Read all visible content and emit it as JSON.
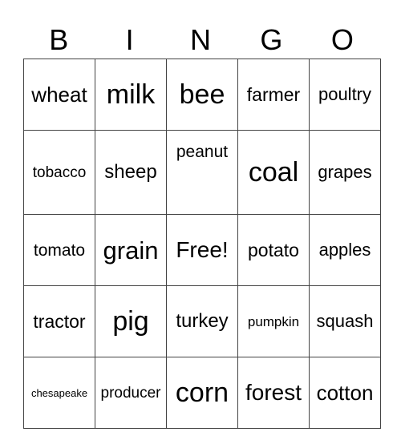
{
  "header": [
    "B",
    "I",
    "N",
    "G",
    "O"
  ],
  "card": [
    [
      "wheat",
      "milk",
      "bee",
      "farmer",
      "poultry"
    ],
    [
      "tobacco",
      "sheep",
      "peanut",
      "coal",
      "grapes"
    ],
    [
      "tomato",
      "grain",
      "Free!",
      "potato",
      "apples"
    ],
    [
      "tractor",
      "pig",
      "turkey",
      "pumpkin",
      "squash"
    ],
    [
      "chesapeake",
      "producer",
      "corn",
      "forest",
      "cotton"
    ]
  ]
}
